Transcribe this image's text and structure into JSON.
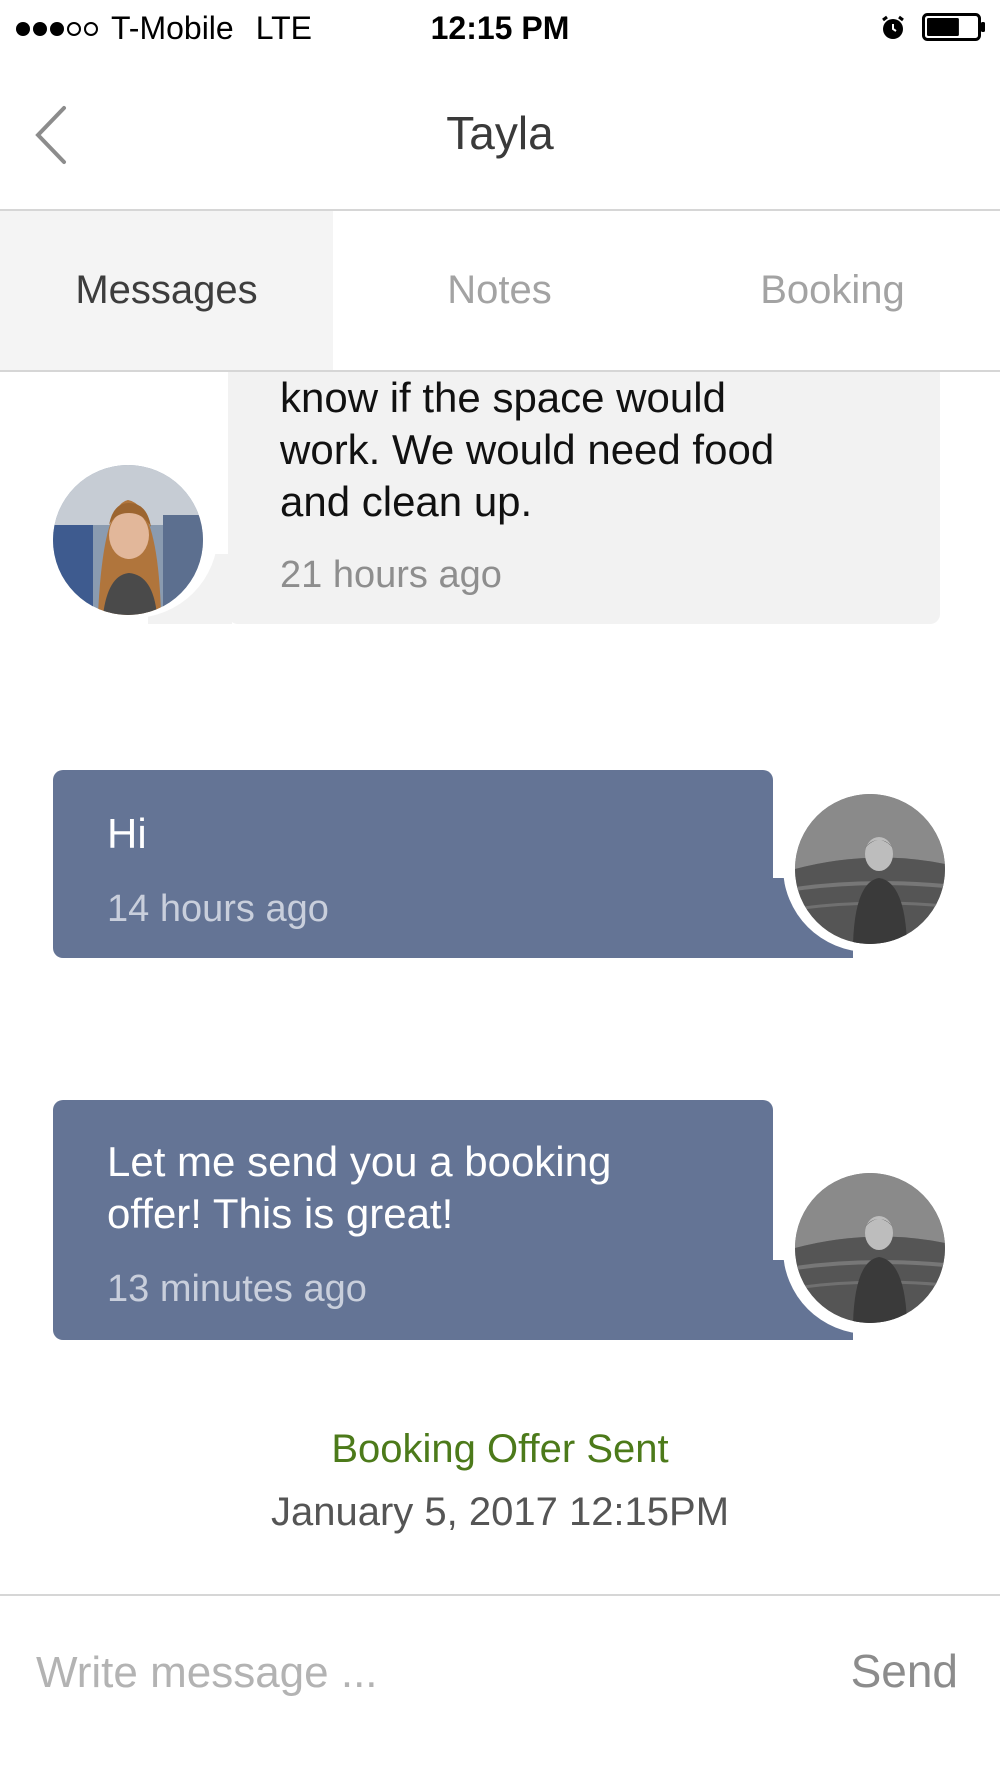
{
  "status_bar": {
    "carrier": "T-Mobile",
    "network": "LTE",
    "time": "12:15 PM",
    "signal_filled": 3,
    "signal_total": 5,
    "battery_level": 0.65
  },
  "nav": {
    "title": "Tayla",
    "back_icon": "chevron-left-icon"
  },
  "tabs": [
    {
      "label": "Messages",
      "active": true
    },
    {
      "label": "Notes",
      "active": false
    },
    {
      "label": "Booking",
      "active": false
    }
  ],
  "messages": [
    {
      "direction": "incoming",
      "text": "know if the space would\nwork. We would need food\nand clean up.",
      "time": "21 hours ago"
    },
    {
      "direction": "outgoing",
      "text": "Hi",
      "time": "14 hours ago"
    },
    {
      "direction": "outgoing",
      "text": "Let me send you a booking\noffer! This is great!",
      "time": "13 minutes ago"
    }
  ],
  "booking_offer": {
    "status": "Booking Offer Sent",
    "date": "January 5, 2017 12:15PM"
  },
  "composer": {
    "placeholder": "Write message ...",
    "value": "",
    "send_label": "Send"
  },
  "colors": {
    "outgoing_bubble": "#647495",
    "incoming_bubble": "#f2f2f2",
    "offer_status": "#4c7a1a"
  }
}
